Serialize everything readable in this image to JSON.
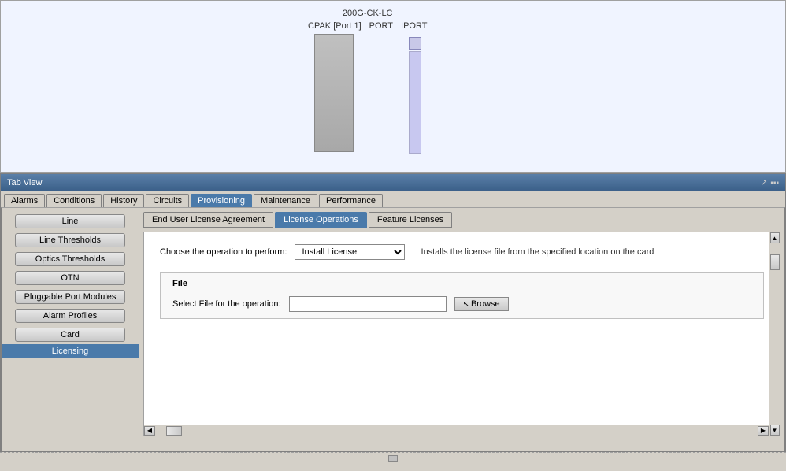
{
  "diagram": {
    "device_title": "200G-CK-LC",
    "port_labels": [
      "CPAK [Port 1]",
      "PORT",
      "IPORT"
    ]
  },
  "tab_view": {
    "title": "Tab View",
    "header_icons": [
      "arrow",
      "menu"
    ]
  },
  "main_tabs": [
    {
      "label": "Alarms",
      "active": false
    },
    {
      "label": "Conditions",
      "active": false
    },
    {
      "label": "History",
      "active": false
    },
    {
      "label": "Circuits",
      "active": false
    },
    {
      "label": "Provisioning",
      "active": true
    },
    {
      "label": "Maintenance",
      "active": false
    },
    {
      "label": "Performance",
      "active": false
    }
  ],
  "sidebar": {
    "items": [
      {
        "label": "Line",
        "active": false
      },
      {
        "label": "Line Thresholds",
        "active": false
      },
      {
        "label": "Optics Thresholds",
        "active": false
      },
      {
        "label": "OTN",
        "active": false
      },
      {
        "label": "Pluggable Port Modules",
        "active": false
      },
      {
        "label": "Alarm Profiles",
        "active": false
      },
      {
        "label": "Card",
        "active": false
      },
      {
        "label": "Licensing",
        "active": true
      }
    ]
  },
  "sub_tabs": [
    {
      "label": "End User License Agreement",
      "active": false
    },
    {
      "label": "License Operations",
      "active": true
    },
    {
      "label": "Feature Licenses",
      "active": false
    }
  ],
  "form": {
    "operation_label": "Choose the operation to perform:",
    "operation_value": "Install License",
    "operation_description": "Installs the license file from the specified location on the card",
    "file_section_title": "File",
    "file_label": "Select File for the operation:",
    "file_placeholder": "",
    "browse_label": "Browse"
  },
  "bottom": {
    "resize_handle": true
  }
}
